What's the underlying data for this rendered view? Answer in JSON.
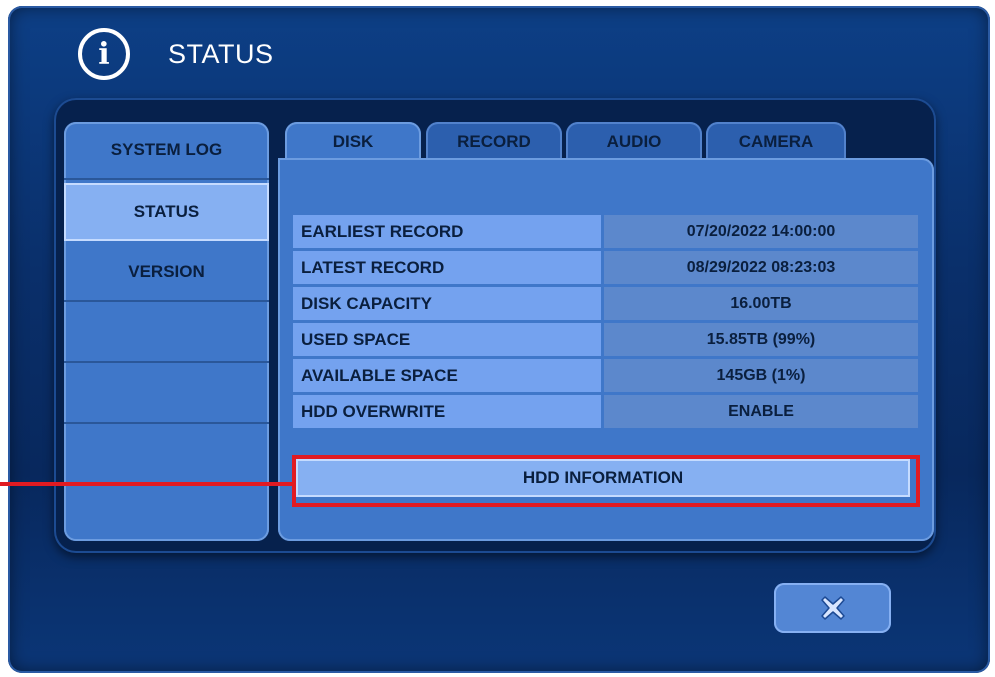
{
  "window": {
    "title": "STATUS",
    "info_icon": "i"
  },
  "sidebar": {
    "items": [
      {
        "label": "SYSTEM LOG"
      },
      {
        "label": "STATUS",
        "active": true
      },
      {
        "label": "VERSION"
      },
      {
        "label": ""
      },
      {
        "label": ""
      },
      {
        "label": ""
      }
    ]
  },
  "tabs": [
    {
      "label": "DISK",
      "active": true
    },
    {
      "label": "RECORD"
    },
    {
      "label": "AUDIO"
    },
    {
      "label": "CAMERA"
    }
  ],
  "disk_info": {
    "rows": [
      {
        "label": "EARLIEST RECORD",
        "value": "07/20/2022 14:00:00"
      },
      {
        "label": "LATEST RECORD",
        "value": "08/29/2022 08:23:03"
      },
      {
        "label": "DISK CAPACITY",
        "value": "16.00TB"
      },
      {
        "label": "USED SPACE",
        "value": "15.85TB (99%)"
      },
      {
        "label": "AVAILABLE SPACE",
        "value": "145GB (1%)"
      },
      {
        "label": "HDD OVERWRITE",
        "value": "ENABLE"
      }
    ]
  },
  "buttons": {
    "hdd_information": "HDD INFORMATION",
    "close_icon": "close-icon"
  },
  "colors": {
    "accent_highlight": "#e11b22",
    "panel_blue": "#3f77c9",
    "label_cell": "#74a2ef",
    "value_cell": "#5c88cc"
  }
}
